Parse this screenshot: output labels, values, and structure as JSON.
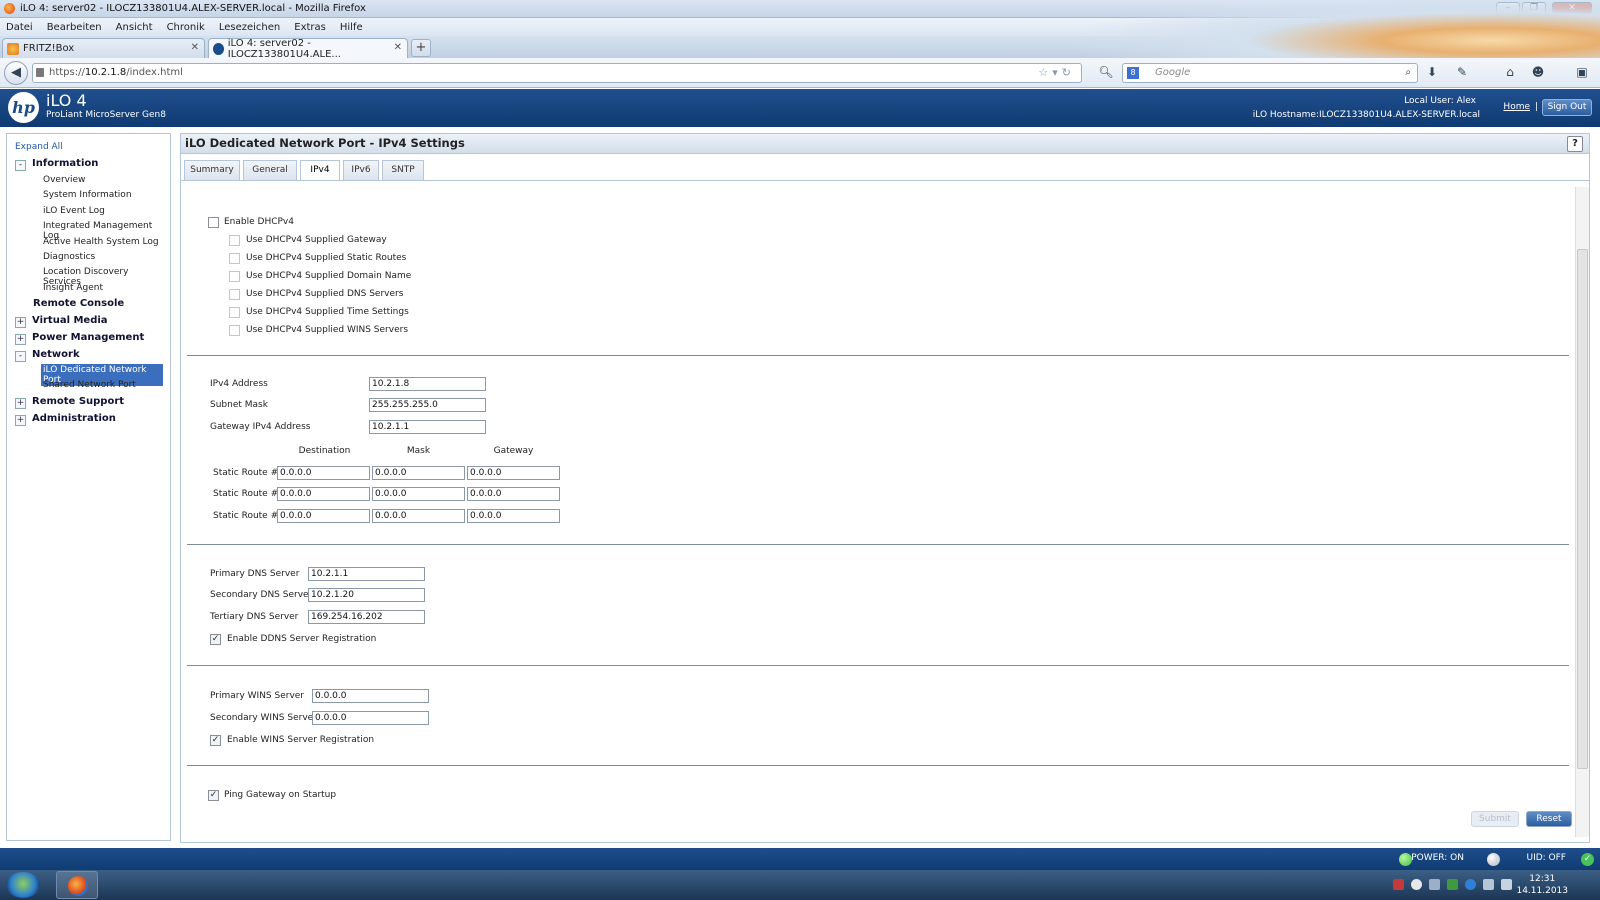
{
  "window": {
    "title": "iLO 4: server02 - ILOCZ133801U4.ALEX-SERVER.local - Mozilla Firefox"
  },
  "menu": [
    "Datei",
    "Bearbeiten",
    "Ansicht",
    "Chronik",
    "Lesezeichen",
    "Extras",
    "Hilfe"
  ],
  "browser_tabs": [
    {
      "label": "FRITZ!Box",
      "active": false
    },
    {
      "label": "iLO 4: server02 - ILOCZ133801U4.ALE...",
      "active": true
    }
  ],
  "address": {
    "prefix": "https://",
    "host": "10.2.1.8",
    "path": "/index.html"
  },
  "search": {
    "placeholder": "Google"
  },
  "header": {
    "logo": "hp",
    "product": "iLO 4",
    "model": "ProLiant MicroServer Gen8",
    "local_user": "Local User:  Alex",
    "hostname": "iLO Hostname:ILOCZ133801U4.ALEX-SERVER.local",
    "home": "Home",
    "separator": "|",
    "sign_out": "Sign Out"
  },
  "sidebar": {
    "expand_all": "Expand All",
    "information": {
      "label": "Information",
      "toggle": "-",
      "items": [
        "Overview",
        "System Information",
        "iLO Event Log",
        "Integrated Management Log",
        "Active Health System Log",
        "Diagnostics",
        "Location Discovery Services",
        "Insight Agent"
      ]
    },
    "remote_console": "Remote Console",
    "virtual_media": {
      "label": "Virtual Media",
      "toggle": "+"
    },
    "power_management": {
      "label": "Power Management",
      "toggle": "+"
    },
    "network": {
      "label": "Network",
      "toggle": "-",
      "items": [
        "iLO Dedicated Network Port",
        "Shared Network Port"
      ],
      "selected": "iLO Dedicated Network Port"
    },
    "remote_support": {
      "label": "Remote Support",
      "toggle": "+"
    },
    "administration": {
      "label": "Administration",
      "toggle": "+"
    }
  },
  "page": {
    "title": "iLO Dedicated Network Port - IPv4 Settings",
    "help": "?",
    "tabs": [
      "Summary",
      "General",
      "IPv4",
      "IPv6",
      "SNTP"
    ],
    "active_tab": "IPv4"
  },
  "dhcp": {
    "enable_label": "Enable DHCPv4",
    "enabled": false,
    "options": [
      "Use DHCPv4 Supplied Gateway",
      "Use DHCPv4 Supplied Static Routes",
      "Use DHCPv4 Supplied Domain Name",
      "Use DHCPv4 Supplied DNS Servers",
      "Use DHCPv4 Supplied Time Settings",
      "Use DHCPv4 Supplied WINS Servers"
    ]
  },
  "address_settings": {
    "ipv4_label": "IPv4 Address",
    "ipv4_value": "10.2.1.8",
    "subnet_label": "Subnet Mask",
    "subnet_value": "255.255.255.0",
    "gateway_label": "Gateway IPv4 Address",
    "gateway_value": "10.2.1.1"
  },
  "static_routes": {
    "headers": [
      "Destination",
      "Mask",
      "Gateway"
    ],
    "rows": [
      {
        "label": "Static Route #1",
        "destination": "0.0.0.0",
        "mask": "0.0.0.0",
        "gateway": "0.0.0.0"
      },
      {
        "label": "Static Route #2",
        "destination": "0.0.0.0",
        "mask": "0.0.0.0",
        "gateway": "0.0.0.0"
      },
      {
        "label": "Static Route #3",
        "destination": "0.0.0.0",
        "mask": "0.0.0.0",
        "gateway": "0.0.0.0"
      }
    ]
  },
  "dns": {
    "primary_label": "Primary DNS Server",
    "primary_value": "10.2.1.1",
    "secondary_label": "Secondary DNS Server",
    "secondary_value": "10.2.1.20",
    "tertiary_label": "Tertiary DNS Server",
    "tertiary_value": "169.254.16.202",
    "ddns_label": "Enable DDNS Server Registration",
    "ddns_checked": true
  },
  "wins": {
    "primary_label": "Primary WINS Server",
    "primary_value": "0.0.0.0",
    "secondary_label": "Secondary WINS Server",
    "secondary_value": "0.0.0.0",
    "registration_label": "Enable WINS Server Registration",
    "registration_checked": true
  },
  "ping": {
    "label": "Ping Gateway on Startup",
    "checked": true
  },
  "buttons": {
    "submit": "Submit",
    "reset": "Reset"
  },
  "status": {
    "power": "POWER: ON",
    "uid": "UID: OFF"
  },
  "taskbar": {
    "time": "12:31",
    "date": "14.11.2013"
  },
  "colors": {
    "hp_blue": "#1b4c8b",
    "selected_nav": "#3b6fbd",
    "power_led": "#3cc23c"
  },
  "check_mark": "✓"
}
